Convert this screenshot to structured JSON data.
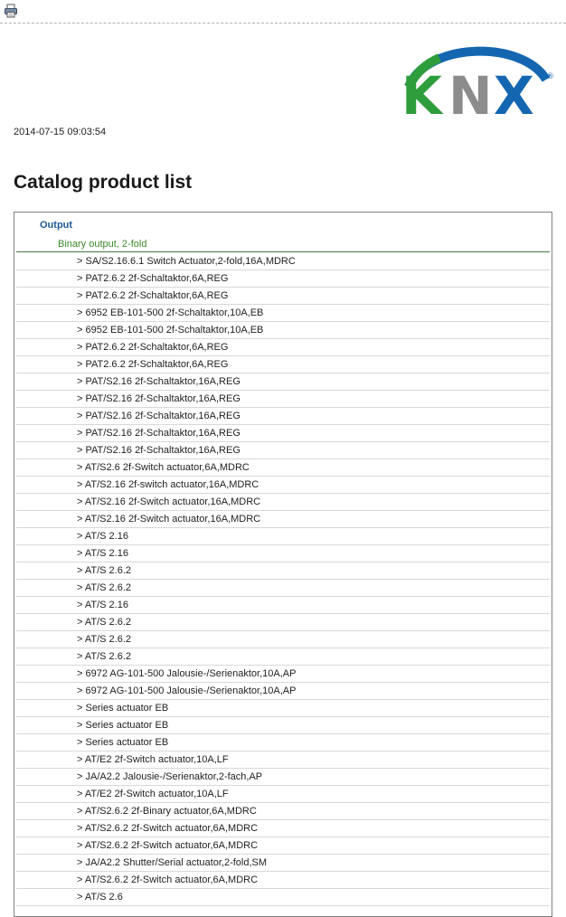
{
  "toolbar": {
    "print_icon": "printer-icon"
  },
  "logo": {
    "text": "KNX",
    "registered_mark": "®",
    "colors": {
      "arc": "#1466b0",
      "k": "#2e9e3c",
      "n": "#8c8c8c",
      "x": "#1466b0"
    }
  },
  "timestamp": "2014-07-15 09:03:54",
  "page_title": "Catalog product list",
  "catalog": {
    "category": "Output",
    "subcategory": "Binary output, 2-fold",
    "products": [
      "> SA/S2.16.6.1 Switch Actuator,2-fold,16A,MDRC",
      "> PAT2.6.2 2f-Schaltaktor,6A,REG",
      "> PAT2.6.2 2f-Schaltaktor,6A,REG",
      "> 6952 EB-101-500 2f-Schaltaktor,10A,EB",
      "> 6952 EB-101-500 2f-Schaltaktor,10A,EB",
      "> PAT2.6.2 2f-Schaltaktor,6A,REG",
      "> PAT2.6.2 2f-Schaltaktor,6A,REG",
      "> PAT/S2.16 2f-Schaltaktor,16A,REG",
      "> PAT/S2.16 2f-Schaltaktor,16A,REG",
      "> PAT/S2.16 2f-Schaltaktor,16A,REG",
      "> PAT/S2.16 2f-Schaltaktor,16A,REG",
      "> PAT/S2.16 2f-Schaltaktor,16A,REG",
      "> AT/S2.6 2f-Switch actuator,6A,MDRC",
      "> AT/S2.16 2f-switch actuator,16A,MDRC",
      "> AT/S2.16 2f-Switch actuator,16A,MDRC",
      "> AT/S2.16 2f-Switch actuator,16A,MDRC",
      "> AT/S 2.16",
      "> AT/S 2.16",
      "> AT/S 2.6.2",
      "> AT/S 2.6.2",
      "> AT/S 2.16",
      "> AT/S 2.6.2",
      "> AT/S 2.6.2",
      "> AT/S 2.6.2",
      "> 6972 AG-101-500 Jalousie-/Serienaktor,10A,AP",
      "> 6972 AG-101-500 Jalousie-/Serienaktor,10A,AP",
      "> Series actuator EB",
      "> Series actuator EB",
      "> Series actuator EB",
      "> AT/E2 2f-Switch actuator,10A,LF",
      "> JA/A2.2 Jalousie-/Serienaktor,2-fach,AP",
      "> AT/E2 2f-Switch actuator,10A,LF",
      "> AT/S2.6.2 2f-Binary actuator,6A,MDRC",
      "> AT/S2.6.2 2f-Switch actuator,6A,MDRC",
      "> AT/S2.6.2 2f-Switch actuator,6A,MDRC",
      "> JA/A2.2 Shutter/Serial actuator,2-fold,SM",
      "> AT/S2.6.2 2f-Switch actuator,6A,MDRC",
      "> AT/S 2.6"
    ]
  }
}
